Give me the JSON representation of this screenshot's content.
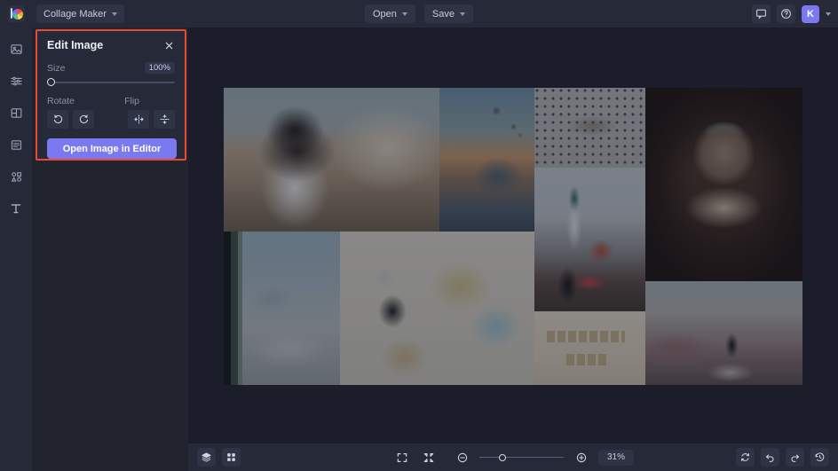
{
  "app": {
    "title": "Collage Maker",
    "logo_icon": "color-wheel-logo"
  },
  "topbar": {
    "open_label": "Open",
    "save_label": "Save",
    "feedback_icon": "chat-bubble-icon",
    "help_icon": "question-circle-icon",
    "avatar_initial": "K",
    "account_chevron_icon": "chevron-down-icon",
    "doc_chevron_icon": "chevron-down-icon",
    "open_chevron_icon": "chevron-down-icon",
    "save_chevron_icon": "chevron-down-icon"
  },
  "sidebar": {
    "items": [
      {
        "name": "images",
        "icon": "image-icon",
        "label": "Images"
      },
      {
        "name": "adjust",
        "icon": "sliders-icon",
        "label": "Adjust"
      },
      {
        "name": "layouts",
        "icon": "layout-icon",
        "label": "Layouts"
      },
      {
        "name": "backgrounds",
        "icon": "stack-lines-icon",
        "label": "Backgrounds"
      },
      {
        "name": "graphics",
        "icon": "shapes-icon",
        "label": "Graphics"
      },
      {
        "name": "text",
        "icon": "text-t-icon",
        "label": "Text"
      }
    ]
  },
  "edit_panel": {
    "title": "Edit Image",
    "close_icon": "close-x-icon",
    "size_label": "Size",
    "size_value": "100%",
    "size_slider_percent": 0,
    "rotate_label": "Rotate",
    "rotate_left_icon": "rotate-counterclockwise-icon",
    "rotate_right_icon": "rotate-clockwise-icon",
    "flip_label": "Flip",
    "flip_horizontal_icon": "flip-horizontal-icon",
    "flip_vertical_icon": "flip-vertical-icon",
    "open_editor_label": "Open Image in Editor",
    "highlight_color": "#e8492f",
    "accent_color": "#7b79f0"
  },
  "canvas": {
    "cells": [
      {
        "name": "photographer-city",
        "alt": "Woman with hat taking a photo over a terracotta rooftop town"
      },
      {
        "name": "hot-air-balloons",
        "alt": "Person watching hot air balloons at sunrise"
      },
      {
        "name": "polka-dot-quote",
        "alt": "Polka dot patterned card with handwritten quote"
      },
      {
        "name": "petra-cave",
        "alt": "View of Petra monastery framed by a cave opening"
      },
      {
        "name": "airplane-window",
        "alt": "Airplane wing seen through a cabin window above clouds"
      },
      {
        "name": "map-camera-passport",
        "alt": "Vintage camera and passport resting on a world map"
      },
      {
        "name": "prague-rooftops",
        "alt": "Woman looking at Prague church spires over red flowers"
      },
      {
        "name": "dream-big-tiles",
        "alt": "Scrabble tiles spelling DREAM BIG"
      },
      {
        "name": "mountain-sunset",
        "alt": "Woman sitting on a rock watching a hazy mountain sunset"
      }
    ]
  },
  "bottombar": {
    "layers_icon": "layers-stack-icon",
    "grid_icon": "grid-four-icon",
    "fit_icon": "fit-to-screen-icon",
    "collapse_icon": "collapse-arrows-icon",
    "zoom_out_icon": "minus-circle-icon",
    "zoom_in_icon": "plus-circle-icon",
    "zoom_value": "31%",
    "zoom_slider_percent": 24,
    "reset_icon": "refresh-icon",
    "undo_icon": "undo-arrow-icon",
    "redo_icon": "redo-arrow-icon",
    "history_icon": "clock-history-icon"
  }
}
